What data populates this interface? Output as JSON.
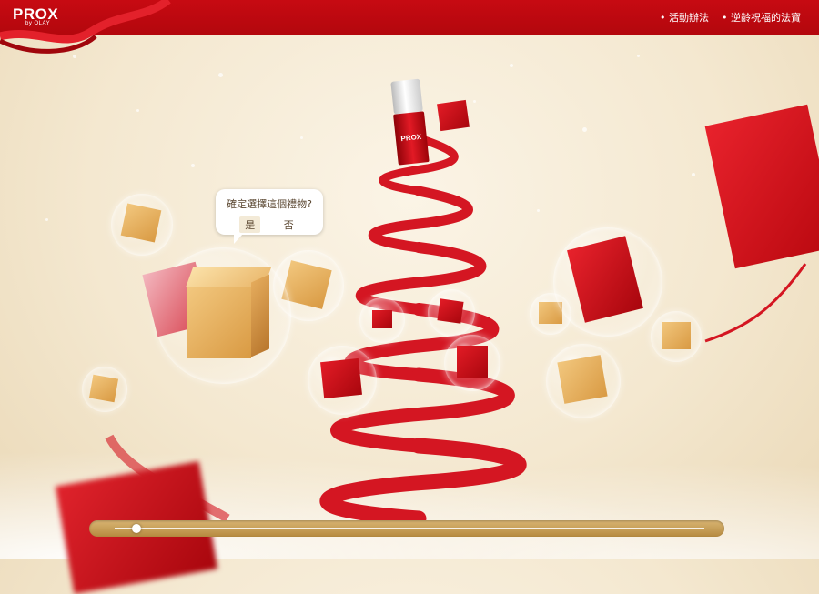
{
  "header": {
    "logo_text": "PROX",
    "logo_sub": "by OLAY",
    "nav": [
      "活動辦法",
      "逆齡祝福的法寶"
    ]
  },
  "dialog": {
    "question": "確定選擇這個禮物?",
    "yes_label": "是",
    "no_label": "否"
  },
  "product": {
    "label": "PROX"
  },
  "slider": {
    "value": 0.03
  },
  "colors": {
    "brand_red": "#c70a12",
    "gold": "#d9a85a",
    "ribbon": "#d41622"
  }
}
